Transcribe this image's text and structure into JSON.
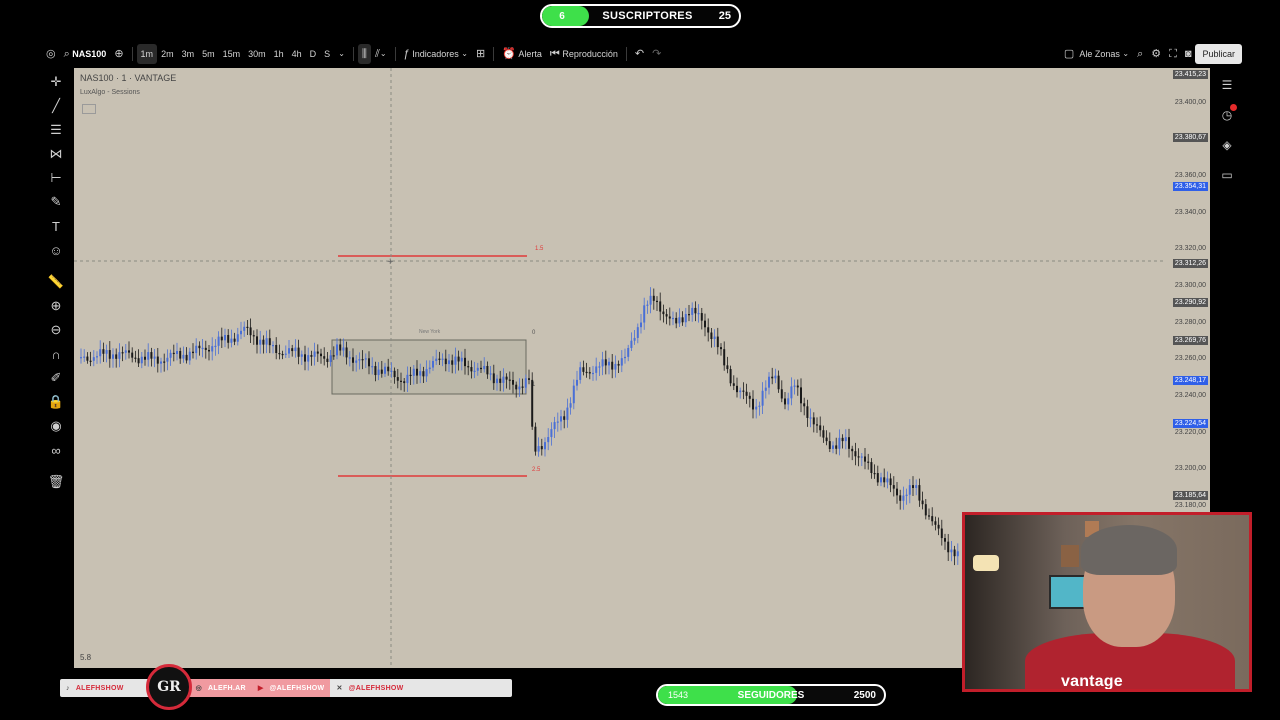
{
  "subscribers": {
    "current": "6",
    "label": "SUSCRIPTORES",
    "goal": "25",
    "progress": 0.24,
    "fill_color": "#3ee04a"
  },
  "toolbar": {
    "symbol": "NAS100",
    "timeframes": [
      "1m",
      "2m",
      "3m",
      "5m",
      "15m",
      "30m",
      "1h",
      "4h",
      "D",
      "S"
    ],
    "active_timeframe": "1m",
    "indicators_label": "Indicadores",
    "alert_label": "Alerta",
    "replay_label": "Reproducción",
    "layout_label": "Ale Zonas",
    "publish_label": "Publicar"
  },
  "left_tools": [
    "crosshair-icon",
    "trend-line-icon",
    "horizontal-lines-icon",
    "pattern-icon",
    "measure-icon",
    "brush-icon",
    "text-icon",
    "emoji-icon",
    "ruler-icon",
    "zoom-in-icon",
    "zoom-out-icon",
    "magnet-icon",
    "pencil-lock-icon",
    "lock-icon",
    "eye-icon",
    "link-icon",
    "trash-icon"
  ],
  "right_tools": [
    "watchlist-icon",
    "alerts-clock-icon",
    "layers-icon",
    "chat-icon"
  ],
  "chart": {
    "title": "NAS100 · 1 · VANTAGE",
    "indicator": "LuxAlgo - Sessions",
    "session_label": "New York",
    "fib_top_label": "1.5",
    "fib_mid_label": "0",
    "fib_one_label": "1",
    "fib_bottom_label": "2.5",
    "corner_label": "5.8",
    "colors": {
      "background": "#c8c1b3",
      "up": "#4a6fd6",
      "down": "#1a1a1a",
      "fib": "#e03a3a",
      "session_box": "#b4b2a2"
    },
    "price_labels": [
      {
        "text": "23.415,23",
        "style": "dark"
      },
      {
        "text": "23.400,00",
        "style": "plain"
      },
      {
        "text": "23.380,67",
        "style": "dark"
      },
      {
        "text": "23.360,00",
        "style": "plain"
      },
      {
        "text": "23.354,31",
        "style": "blue"
      },
      {
        "text": "23.340,00",
        "style": "plain"
      },
      {
        "text": "23.320,00",
        "style": "plain"
      },
      {
        "text": "23.312,26",
        "style": "dark"
      },
      {
        "text": "23.300,00",
        "style": "plain"
      },
      {
        "text": "23.290,92",
        "style": "dark"
      },
      {
        "text": "23.280,00",
        "style": "plain"
      },
      {
        "text": "23.269,76",
        "style": "dark"
      },
      {
        "text": "23.260,00",
        "style": "plain"
      },
      {
        "text": "23.248,17",
        "style": "blue"
      },
      {
        "text": "23.240,00",
        "style": "plain"
      },
      {
        "text": "23.224,54",
        "style": "blue"
      },
      {
        "text": "23.220,00",
        "style": "plain"
      },
      {
        "text": "23.200,00",
        "style": "plain"
      },
      {
        "text": "23.185,64",
        "style": "dark"
      },
      {
        "text": "23.180,00",
        "style": "plain"
      }
    ]
  },
  "social": {
    "items": [
      "ALEFHSHOW",
      "ALEFH.AR",
      "@ALEFHSHOW",
      "@ALEFHSHOW"
    ],
    "logo_text": "GR"
  },
  "followers": {
    "current": "1543",
    "label": "SEGUIDORES",
    "goal": "2500",
    "progress": 0.617,
    "fill_color": "#3ee04a"
  },
  "webcam": {
    "brand": "vantage"
  }
}
